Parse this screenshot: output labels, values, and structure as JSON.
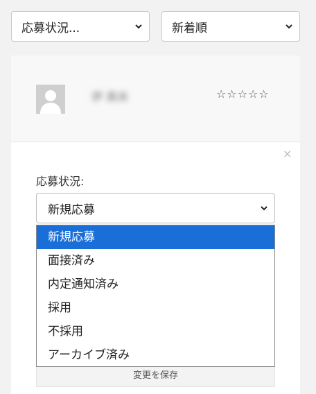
{
  "filters": {
    "status_value": "応募状況...",
    "sort_value": "新着順"
  },
  "applicant": {
    "name": "伊 真央",
    "rating_stars": "☆☆☆☆☆",
    "rating_value": 0,
    "rating_max": 5
  },
  "form": {
    "close_symbol": "×",
    "status_label": "応募状況:",
    "status_selected": "新規応募",
    "save_label": "変更を保存"
  },
  "dropdown": {
    "options": [
      "新規応募",
      "面接済み",
      "内定通知済み",
      "採用",
      "不採用",
      "アーカイブ済み"
    ]
  },
  "colors": {
    "selected_option_bg": "#1a6ed8",
    "page_bg": "#f2f2f2"
  }
}
